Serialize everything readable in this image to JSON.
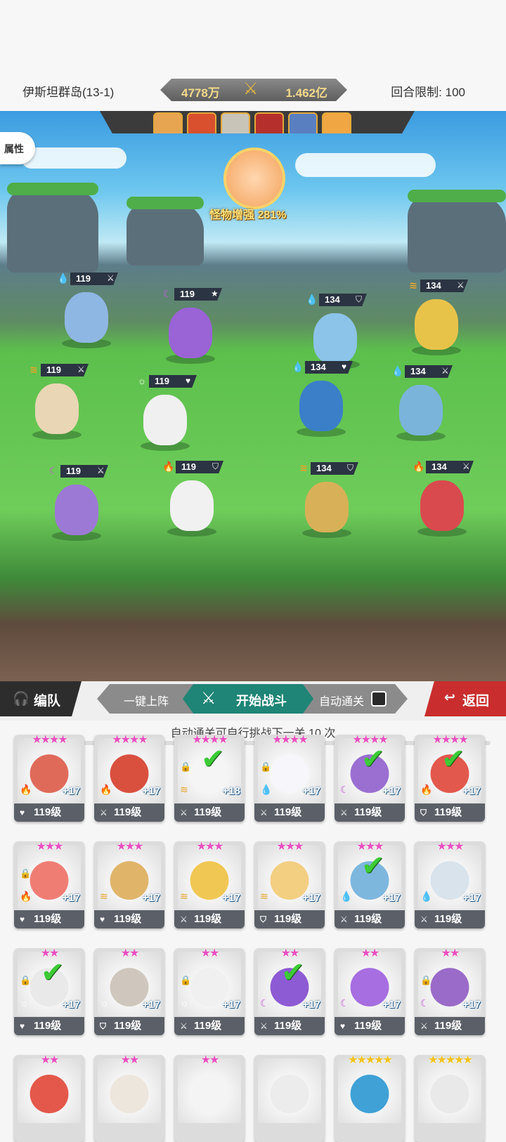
{
  "header": {
    "stage_name": "伊斯坦群岛(13-1)",
    "my_power": "4778万",
    "enemy_power": "1.462亿",
    "round_limit": "回合限制: 100"
  },
  "battle": {
    "attr_button": "属性",
    "monster_boost": "怪物增强 281%",
    "enemy_portraits": [
      {
        "color": "#e7a552"
      },
      {
        "color": "#d9502e"
      },
      {
        "color": "#c9c4b8"
      },
      {
        "color": "#b5302c"
      },
      {
        "color": "#5a7fc0"
      },
      {
        "color": "#f0a642"
      }
    ],
    "units": [
      {
        "level": "119",
        "element": "water",
        "role": "attack"
      },
      {
        "level": "119",
        "element": "moon",
        "role": "star"
      },
      {
        "level": "119",
        "element": "wind",
        "role": "attack"
      },
      {
        "level": "119",
        "element": "sun",
        "role": "heart"
      },
      {
        "level": "119",
        "element": "moon",
        "role": "attack"
      },
      {
        "level": "119",
        "element": "fire",
        "role": "shield"
      },
      {
        "level": "134",
        "element": "water",
        "role": "shield"
      },
      {
        "level": "134",
        "element": "wind",
        "role": "attack"
      },
      {
        "level": "134",
        "element": "water",
        "role": "heart"
      },
      {
        "level": "134",
        "element": "water",
        "role": "attack"
      },
      {
        "level": "134",
        "element": "wind",
        "role": "shield"
      },
      {
        "level": "134",
        "element": "fire",
        "role": "attack"
      }
    ]
  },
  "actions": {
    "team_label": "编队",
    "one_key_label": "一键上阵",
    "start_label": "开始战斗",
    "auto_label": "自动通关",
    "back_label": "返回"
  },
  "hint": "自动通关可自行挑战下一关 10 次",
  "roster": [
    {
      "stars": "★★★★",
      "plus": "+17",
      "level": "119级",
      "cls": "heart",
      "elem": "fire",
      "check": false,
      "lock": false,
      "color": "#e06a5a"
    },
    {
      "stars": "★★★★",
      "plus": "+17",
      "level": "119级",
      "cls": "attack",
      "elem": "fire",
      "check": false,
      "lock": false,
      "color": "#d9503f"
    },
    {
      "stars": "★★★★",
      "plus": "+18",
      "level": "119级",
      "cls": "attack",
      "elem": "wind",
      "check": true,
      "lock": true,
      "color": "#f5f5f5"
    },
    {
      "stars": "★★★★",
      "plus": "+17",
      "level": "119级",
      "cls": "attack",
      "elem": "water",
      "check": false,
      "lock": true,
      "color": "#f7f7fb"
    },
    {
      "stars": "★★★★",
      "plus": "+17",
      "level": "119级",
      "cls": "attack",
      "elem": "moon",
      "check": true,
      "lock": false,
      "color": "#9a6fd1"
    },
    {
      "stars": "★★★★",
      "plus": "+17",
      "level": "119级",
      "cls": "shield",
      "elem": "fire",
      "check": true,
      "lock": false,
      "color": "#e2584c"
    },
    {
      "stars": "★★★",
      "plus": "+17",
      "level": "119级",
      "cls": "heart",
      "elem": "fire",
      "check": false,
      "lock": true,
      "color": "#f07d74"
    },
    {
      "stars": "★★★",
      "plus": "+17",
      "level": "119级",
      "cls": "heart",
      "elem": "wind",
      "check": false,
      "lock": false,
      "color": "#e0b56a"
    },
    {
      "stars": "★★★",
      "plus": "+17",
      "level": "119级",
      "cls": "attack",
      "elem": "wind",
      "check": false,
      "lock": false,
      "color": "#f1c753"
    },
    {
      "stars": "★★★",
      "plus": "+17",
      "level": "119级",
      "cls": "shield",
      "elem": "wind",
      "check": false,
      "lock": false,
      "color": "#f3cf82"
    },
    {
      "stars": "★★★",
      "plus": "+17",
      "level": "119级",
      "cls": "attack",
      "elem": "water",
      "check": true,
      "lock": false,
      "color": "#7db7de"
    },
    {
      "stars": "★★★",
      "plus": "+17",
      "level": "119级",
      "cls": "attack",
      "elem": "water",
      "check": false,
      "lock": false,
      "color": "#d8e3ec"
    },
    {
      "stars": "★★",
      "plus": "+17",
      "level": "119级",
      "cls": "heart",
      "elem": "sun",
      "check": true,
      "lock": true,
      "color": "#e9e9e9"
    },
    {
      "stars": "★★",
      "plus": "+17",
      "level": "119级",
      "cls": "shield",
      "elem": "sun",
      "check": false,
      "lock": false,
      "color": "#cfc7bd"
    },
    {
      "stars": "★★",
      "plus": "+17",
      "level": "119级",
      "cls": "attack",
      "elem": "sun",
      "check": false,
      "lock": true,
      "color": "#f0f0f0"
    },
    {
      "stars": "★★",
      "plus": "+17",
      "level": "119级",
      "cls": "attack",
      "elem": "moon",
      "check": true,
      "lock": false,
      "color": "#8d5bd3"
    },
    {
      "stars": "★★",
      "plus": "+17",
      "level": "119级",
      "cls": "heart",
      "elem": "moon",
      "check": false,
      "lock": false,
      "color": "#a66ee0"
    },
    {
      "stars": "★★",
      "plus": "+17",
      "level": "119级",
      "cls": "attack",
      "elem": "moon",
      "check": false,
      "lock": true,
      "color": "#9a6bc8"
    },
    {
      "stars": "★★",
      "plus": "",
      "level": "",
      "cls": "",
      "elem": "",
      "check": false,
      "lock": false,
      "color": "#e3584a",
      "partial": true
    },
    {
      "stars": "★★",
      "plus": "",
      "level": "",
      "cls": "",
      "elem": "",
      "check": false,
      "lock": false,
      "color": "#ede6dc",
      "partial": true
    },
    {
      "stars": "★★",
      "plus": "",
      "level": "",
      "cls": "",
      "elem": "",
      "check": false,
      "lock": false,
      "color": "#f4f4f4",
      "partial": true
    },
    {
      "stars": "",
      "plus": "",
      "level": "",
      "cls": "",
      "elem": "",
      "check": false,
      "lock": false,
      "color": "#ececec",
      "partial": true
    },
    {
      "stars": "★★★★★",
      "plus": "",
      "level": "",
      "cls": "",
      "elem": "",
      "check": false,
      "lock": false,
      "color": "#3fa1d6",
      "partial": true,
      "gold": true
    },
    {
      "stars": "★★★★★",
      "plus": "",
      "level": "",
      "cls": "",
      "elem": "",
      "check": false,
      "lock": false,
      "color": "#e9e9e9",
      "partial": true,
      "gold": true
    }
  ]
}
